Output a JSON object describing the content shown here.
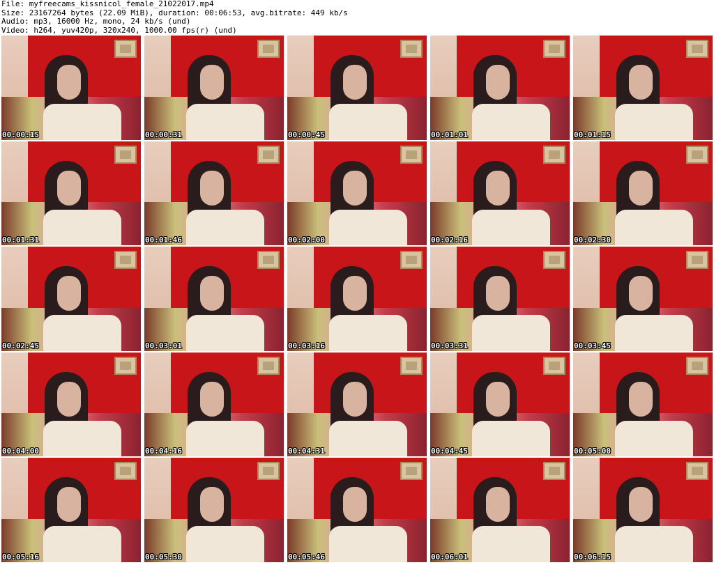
{
  "header": {
    "file": "File: myfreecams_kissnicol_female_21022017.mp4",
    "size": "Size: 23167264 bytes (22.09 MiB), duration: 00:06:53, avg.bitrate: 449 kb/s",
    "audio": "Audio: mp3, 16000 Hz, mono, 24 kb/s (und)",
    "video": "Video: h264, yuv420p, 320x240, 1000.00 fps(r) (und)"
  },
  "thumbnails": [
    {
      "timestamp": "00:00:15"
    },
    {
      "timestamp": "00:00:31"
    },
    {
      "timestamp": "00:00:45"
    },
    {
      "timestamp": "00:01:01"
    },
    {
      "timestamp": "00:01:15"
    },
    {
      "timestamp": "00:01:31"
    },
    {
      "timestamp": "00:01:46"
    },
    {
      "timestamp": "00:02:00"
    },
    {
      "timestamp": "00:02:16"
    },
    {
      "timestamp": "00:02:30"
    },
    {
      "timestamp": "00:02:45"
    },
    {
      "timestamp": "00:03:01"
    },
    {
      "timestamp": "00:03:16"
    },
    {
      "timestamp": "00:03:31"
    },
    {
      "timestamp": "00:03:45"
    },
    {
      "timestamp": "00:04:00"
    },
    {
      "timestamp": "00:04:16"
    },
    {
      "timestamp": "00:04:31"
    },
    {
      "timestamp": "00:04:45"
    },
    {
      "timestamp": "00:05:00"
    },
    {
      "timestamp": "00:05:16"
    },
    {
      "timestamp": "00:05:30"
    },
    {
      "timestamp": "00:05:46"
    },
    {
      "timestamp": "00:06:01"
    },
    {
      "timestamp": "00:06:15"
    }
  ]
}
